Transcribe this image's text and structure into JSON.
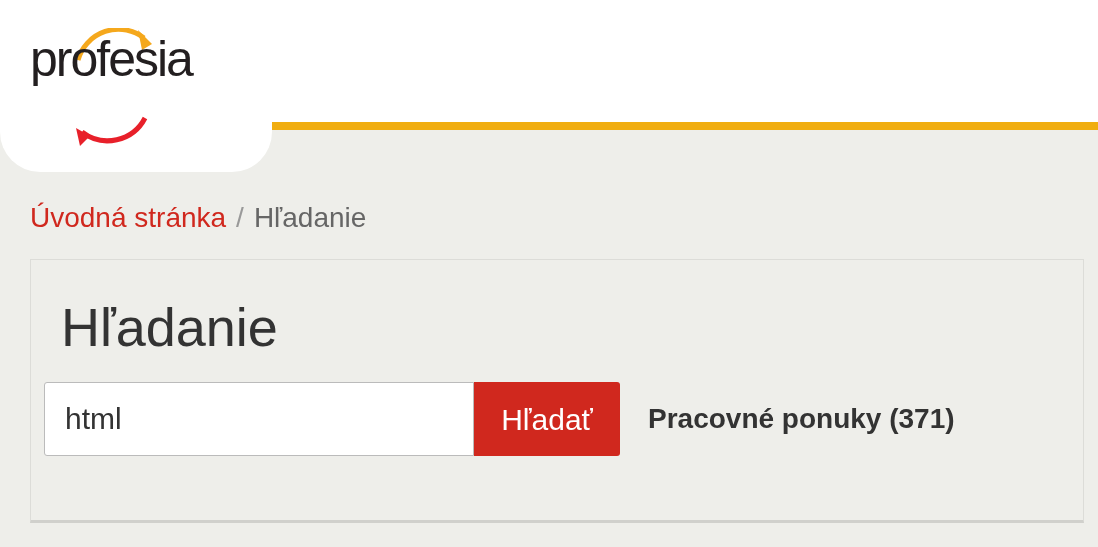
{
  "logo": {
    "text": "profesia"
  },
  "breadcrumb": [
    {
      "label": "Úvodná stránka",
      "kind": "link"
    },
    {
      "label": "/",
      "kind": "separator"
    },
    {
      "label": "Hľadanie",
      "kind": "current"
    }
  ],
  "search": {
    "title": "Hľadanie",
    "value": "html",
    "button": "Hľadať",
    "result": "Pracovné ponuky (371)"
  }
}
